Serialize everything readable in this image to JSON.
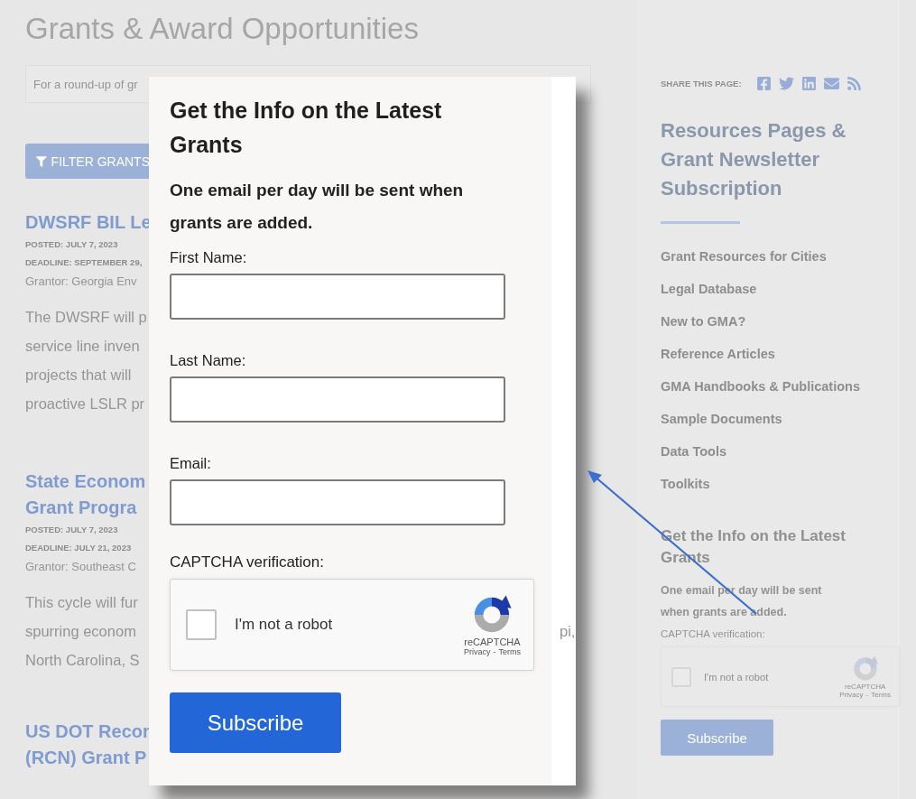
{
  "page_title": "Grants & Award Opportunities",
  "search": {
    "placeholder": "For a round-up of gr"
  },
  "filter_button": "FILTER GRANTS",
  "grants": [
    {
      "title_lines": [
        "DWSRF BIL Le"
      ],
      "posted": "POSTED: JULY 7, 2023",
      "deadline": "DEADLINE: SEPTEMBER 29,",
      "grantor": "Grantor: Georgia Env",
      "body_lines": [
        {
          "text": "The DWSRF will p"
        },
        {
          "text": "service line inven"
        },
        {
          "text": "projects that will"
        },
        {
          "text": "proactive LSLR pr"
        }
      ]
    },
    {
      "title_lines": [
        "State Econom",
        "Grant Progra"
      ],
      "posted": "POSTED: JULY 7, 2023",
      "deadline": "DEADLINE: JULY 21, 2023",
      "grantor": "Grantor: Southeast C",
      "body_lines": [
        {
          "text": "This cycle will fur"
        },
        {
          "text": "spurring econom",
          "tail": "pi,"
        },
        {
          "text": "North Carolina, S"
        }
      ]
    },
    {
      "title_lines": [
        "US DOT Recon",
        "(RCN) Grant P"
      ]
    }
  ],
  "sidebar": {
    "share_label": "SHARE THIS PAGE:",
    "heading": "Resources Pages & Grant Newsletter Subscription",
    "links": [
      {
        "label": "Grant Resources for Cities"
      },
      {
        "label": "Legal Database"
      },
      {
        "label": "New to GMA?"
      },
      {
        "label": "Reference Articles"
      },
      {
        "label": "GMA Handbooks & Publications"
      },
      {
        "label": "Sample Documents"
      },
      {
        "label": "Data Tools"
      },
      {
        "label": "Toolkits"
      }
    ],
    "newsletter": {
      "heading": "Get the Info on the Latest Grants",
      "text": "One email per day will be sent when grants are added.",
      "captcha_label": "CAPTCHA verification:",
      "captcha": {
        "label": "I'm not a robot",
        "checked": false,
        "brand": "reCAPTCHA",
        "privacy": "Privacy",
        "separator": "-",
        "terms": "Terms"
      },
      "button": "Subscribe"
    }
  },
  "popup": {
    "title": "Get the Info on the Latest Grants",
    "subtitle": "One email per day will be sent when grants are added.",
    "fields": [
      {
        "label": "First Name:"
      },
      {
        "label": "Last Name:"
      },
      {
        "label": "Email:"
      }
    ],
    "captcha_label": "CAPTCHA verification:",
    "captcha": {
      "label": "I'm not a robot",
      "checked": false,
      "brand": "reCAPTCHA",
      "privacy": "Privacy",
      "separator": "-",
      "terms": "Terms"
    },
    "button": "Subscribe"
  }
}
